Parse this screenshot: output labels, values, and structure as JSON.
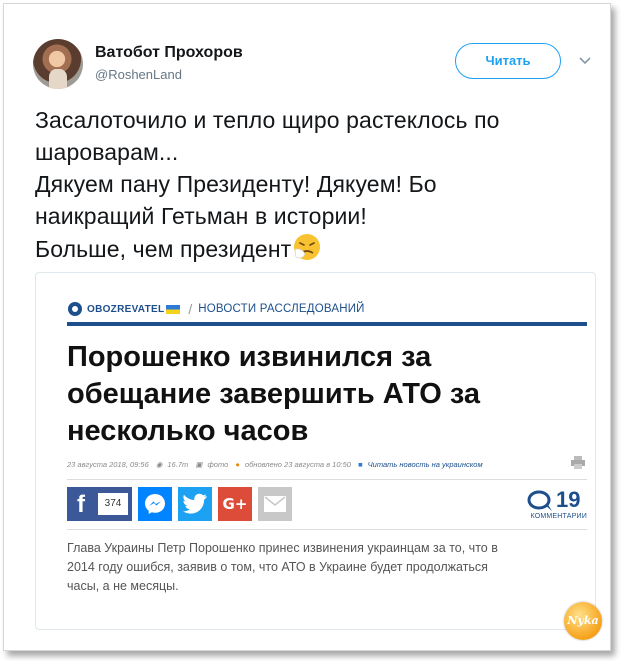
{
  "tweet": {
    "author_name": "Ватобот Прохоров",
    "author_handle": "@RoshenLand",
    "follow_label": "Читать",
    "lines": [
      "Засалоточило и тепло щиро растеклось по",
      "шароварам...",
      "Дякуем пану Президенту! Дякуем! Бо",
      "наикращий Гетьман в истории!",
      "Больше, чем президент"
    ],
    "emoji": "sneezing-face-emoji"
  },
  "article": {
    "site_name": "OBOZREVATEL",
    "section": "НОВОСТИ РАССЛЕДОВАНИЙ",
    "headline_lines": [
      "Порошенко извинился за",
      "обещание завершить АТО за",
      "несколько часов"
    ],
    "meta": {
      "date": "23 августа 2018, 09:56",
      "views": "16.7т",
      "photo": "фото",
      "updated": "обновлено 23 августа в 10:50",
      "read_ukrainian": "Читать новость на украинском"
    },
    "facebook_count": "374",
    "comments_count": "19",
    "comments_label": "КОММЕНТАРИИ",
    "lead_lines": [
      "Глава Украины Петр Порошенко принес извинения украинцам за то, что в",
      "2014 году ошибся, заявив о том, что АТО в Украине будет продолжаться",
      "часы, а не месяцы."
    ],
    "colors": {
      "brand_blue": "#1d4f8c",
      "facebook": "#3b5998",
      "messenger": "#0084ff",
      "twitter": "#1da1f2",
      "google_plus": "#dd4b39",
      "email": "#c8c8c8"
    }
  },
  "watermark": "Nyka"
}
